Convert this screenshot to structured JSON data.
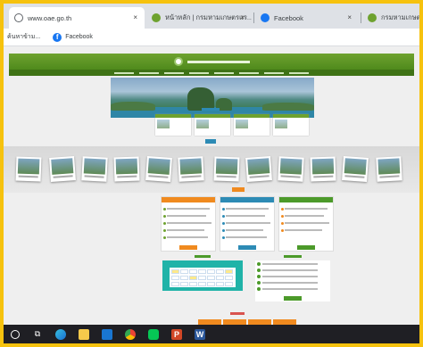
{
  "browser": {
    "tabs": [
      {
        "title": "www.oae.go.th",
        "favicon": "globe-icon",
        "active": true,
        "favcolor": "#5f6368"
      },
      {
        "title": "หน้าหลัก | กรมหามเกษตรแร...",
        "favicon": "site-green-icon",
        "active": false,
        "favcolor": "#6ea22f"
      },
      {
        "title": "Facebook",
        "favicon": "facebook-icon",
        "active": false,
        "favcolor": "#1877f2"
      },
      {
        "title": "กรมหามเกษตรแห",
        "favicon": "site-green-icon",
        "active": false,
        "favcolor": "#6ea22f"
      }
    ],
    "close_glyph": "×",
    "bookmarks": [
      {
        "label": "ค้นหาข้าม...",
        "icon": "none"
      },
      {
        "label": "Facebook",
        "icon": "facebook-icon"
      }
    ]
  },
  "colors": {
    "frame_border": "#f6c20e",
    "site_green": "#4f8a1c",
    "accent_blue": "#2d8bb5",
    "accent_orange": "#f08a1f",
    "accent_teal": "#20b3a8",
    "taskbar": "#1f1f24"
  },
  "taskbar": {
    "icons": [
      {
        "name": "search-icon",
        "glyph": "○"
      },
      {
        "name": "task-view-icon",
        "glyph": "⧉"
      },
      {
        "name": "edge-icon",
        "glyph": "◉"
      },
      {
        "name": "file-explorer-icon",
        "glyph": "▆"
      },
      {
        "name": "mail-icon",
        "glyph": "✉"
      },
      {
        "name": "chrome-icon",
        "glyph": "◍"
      },
      {
        "name": "line-icon",
        "glyph": "◼"
      },
      {
        "name": "powerpoint-icon",
        "glyph": "P"
      },
      {
        "name": "word-icon",
        "glyph": "W"
      }
    ]
  }
}
